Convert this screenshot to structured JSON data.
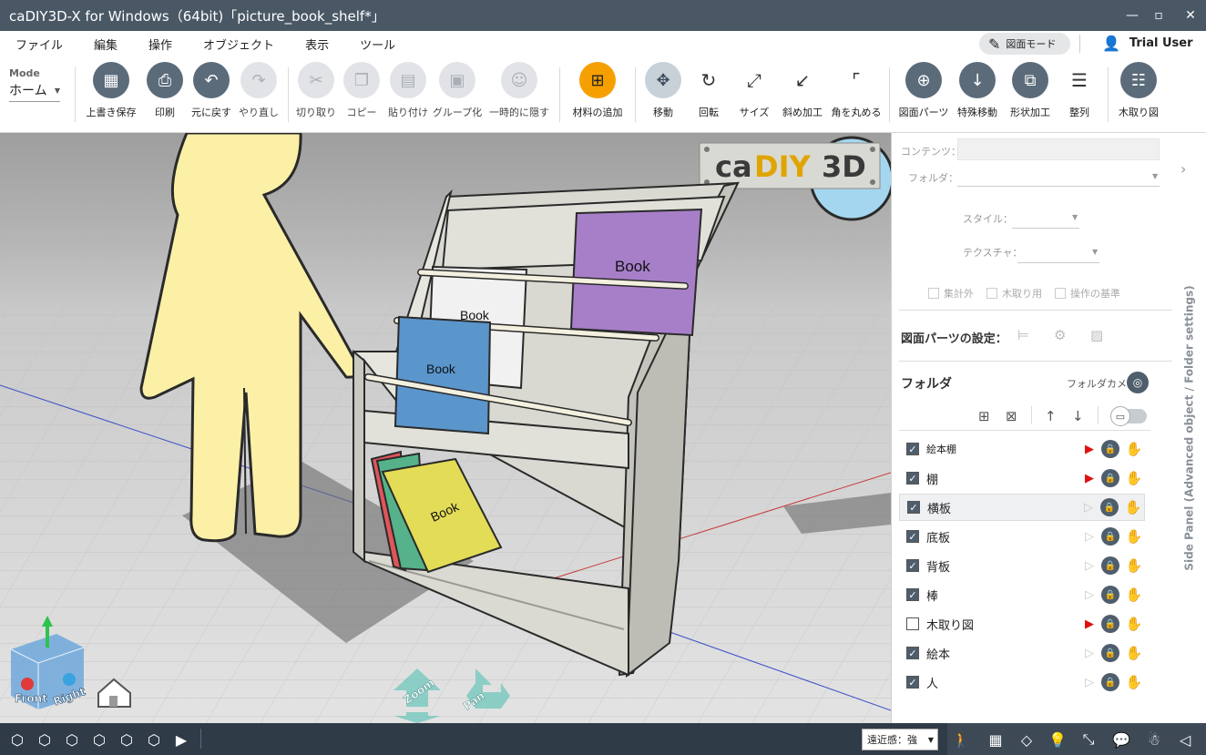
{
  "window": {
    "title": "caDIY3D-X for Windows（64bit)「picture_book_shelf*」",
    "minimize_icon": "minimize-icon",
    "maximize_icon": "maximize-icon",
    "close_icon": "close-icon"
  },
  "menu": {
    "items": [
      "ファイル",
      "編集",
      "操作",
      "オブジェクト",
      "表示",
      "ツール"
    ]
  },
  "header": {
    "draw_mode_label": "図面モード",
    "user_name": "Trial User"
  },
  "toolbar": {
    "mode_label": "Mode",
    "mode_value": "ホーム",
    "buttons": [
      {
        "label": "上書き保存",
        "icon": "save-icon",
        "glyph": "💾"
      },
      {
        "label": "印刷",
        "icon": "print-icon",
        "glyph": "🖨"
      },
      {
        "label": "元に戻す",
        "icon": "undo-icon",
        "glyph": "↶"
      },
      {
        "label": "やり直し",
        "icon": "redo-icon",
        "glyph": "↷"
      },
      {
        "label": "切り取り",
        "icon": "cut-icon",
        "glyph": "✂"
      },
      {
        "label": "コピー",
        "icon": "copy-icon",
        "glyph": "❐"
      },
      {
        "label": "貼り付け",
        "icon": "paste-icon",
        "glyph": "📋"
      },
      {
        "label": "グループ化",
        "icon": "group-icon",
        "glyph": "▣"
      },
      {
        "label": "一時的に隠す",
        "icon": "hide-icon",
        "glyph": "☺"
      },
      {
        "label": "材料の追加",
        "icon": "add-material-icon",
        "glyph": "⊞"
      },
      {
        "label": "移動",
        "icon": "move-icon",
        "glyph": "✥"
      },
      {
        "label": "回転",
        "icon": "rotate-icon",
        "glyph": "↻"
      },
      {
        "label": "サイズ",
        "icon": "resize-icon",
        "glyph": "⤢"
      },
      {
        "label": "斜め加工",
        "icon": "bevel-icon",
        "glyph": "↙"
      },
      {
        "label": "角を丸める",
        "icon": "round-corner-icon",
        "glyph": "⌜"
      },
      {
        "label": "図面パーツ",
        "icon": "drawing-parts-icon",
        "glyph": "⊕"
      },
      {
        "label": "特殊移動",
        "icon": "special-move-icon",
        "glyph": "↓"
      },
      {
        "label": "形状加工",
        "icon": "shape-process-icon",
        "glyph": "⧉"
      },
      {
        "label": "整列",
        "icon": "align-icon",
        "glyph": "☰"
      },
      {
        "label": "木取り図",
        "icon": "cut-list-icon",
        "glyph": "☷"
      }
    ]
  },
  "viewport": {
    "logo_text_1": "ca",
    "logo_text_2": "DIY",
    "logo_text_3": "3D",
    "book_label": "Book",
    "zoom_label": "Zoom",
    "pan_label": "Pan",
    "cube_front": "Front",
    "cube_right": "Right",
    "colors": {
      "background_top": "#a9a9a9",
      "floor": "#d9d9d9",
      "wood": "#e3e3dd",
      "person": "#fbf0a6",
      "book_purple": "#a77fc9",
      "book_white": "#f1f1f1",
      "book_blue": "#5a95cc",
      "book_yellow": "#e3dc57",
      "book_green": "#55b28a",
      "book_red": "#e0555a"
    }
  },
  "side_panel": {
    "contents_label": "コンテンツ：",
    "folder_label": "フォルダ：",
    "style_label": "スタイル：",
    "texture_label": "テクスチャ：",
    "checks": [
      "集計外",
      "木取り用",
      "操作の基準"
    ],
    "drawing_parts_settings": "図面パーツの設定：",
    "folder_title": "フォルダ",
    "folder_camera": "フォルダカメラ",
    "vertical_tab": "Side Panel (Advanced object / Folder settings)",
    "folders": [
      {
        "name": "絵本棚",
        "checked": true,
        "play": true,
        "eye_color": "#3a76c4",
        "small": true
      },
      {
        "name": "棚",
        "checked": true,
        "play": true,
        "eye_color": "#e87c3a",
        "small": false
      },
      {
        "name": "横板",
        "checked": true,
        "play": false,
        "eye_color": "#9a9a9a",
        "small": false,
        "selected": true
      },
      {
        "name": "底板",
        "checked": true,
        "play": false,
        "eye_color": "#e8b51a",
        "small": false
      },
      {
        "name": "背板",
        "checked": true,
        "play": false,
        "eye_color": "#2f5ea8",
        "small": false
      },
      {
        "name": "棒",
        "checked": true,
        "play": false,
        "eye_color": "#5f9a3a",
        "small": false
      },
      {
        "name": "木取り図",
        "checked": false,
        "play": true,
        "eye_color": "#7a5a10",
        "small": false
      },
      {
        "name": "絵本",
        "checked": true,
        "play": false,
        "eye_color": "#1e3a6a",
        "small": false
      },
      {
        "name": "人",
        "checked": true,
        "play": false,
        "eye_color": "#3a5a1e",
        "small": false
      }
    ]
  },
  "statusbar": {
    "perspective_label": "遠近感：強"
  }
}
